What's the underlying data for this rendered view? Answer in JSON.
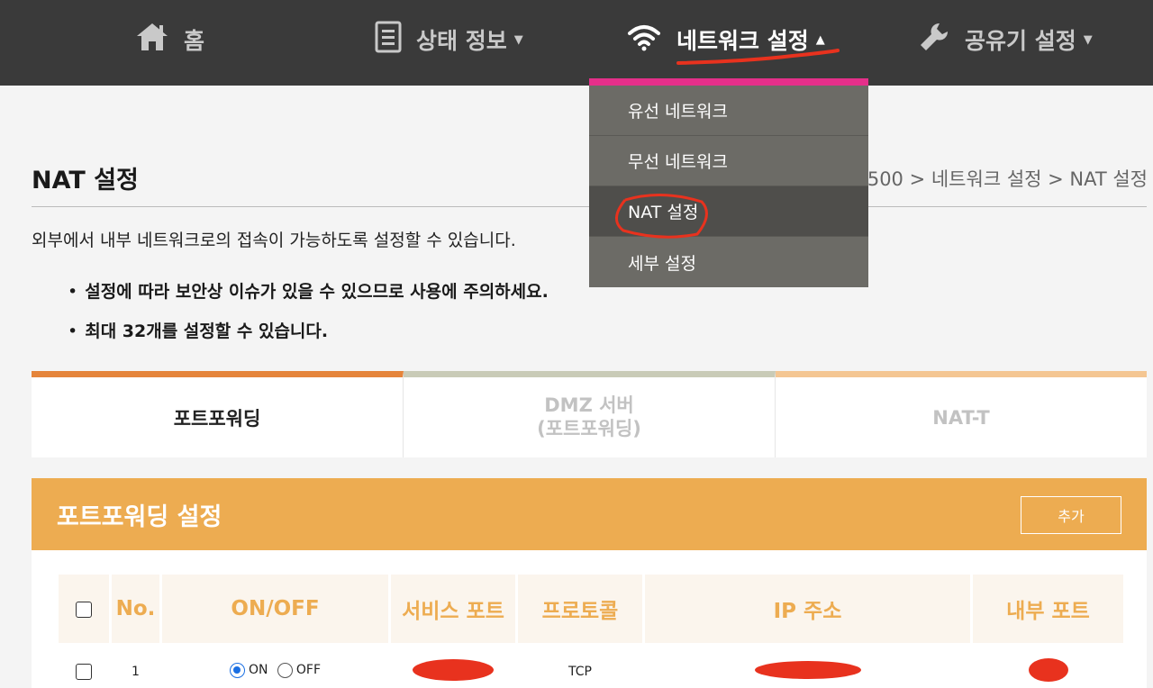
{
  "nav": {
    "items": [
      {
        "label": "홈",
        "icon": "home-icon"
      },
      {
        "label": "상태 정보",
        "icon": "document-icon"
      },
      {
        "label": "네트워크 설정",
        "icon": "wifi-icon"
      },
      {
        "label": "공유기 설정",
        "icon": "wrench-icon"
      }
    ]
  },
  "dropdown": {
    "items": [
      "유선 네트워크",
      "무선 네트워크",
      "NAT 설정",
      "세부 설정"
    ]
  },
  "page": {
    "title": "NAT 설정",
    "breadcrumb": "M-7500 > 네트워크 설정 > NAT 설정",
    "description": "외부에서 내부 네트워크로의 접속이 가능하도록 설정할 수 있습니다.",
    "bullets": [
      "설정에 따라 보안상 이슈가 있을 수 있으므로 사용에 주의하세요.",
      "최대 32개를 설정할 수 있습니다."
    ]
  },
  "tabs": [
    {
      "label": "포트포워딩"
    },
    {
      "label_line1": "DMZ 서버",
      "label_line2": "(포트포워딩)"
    },
    {
      "label": "NAT-T"
    }
  ],
  "panel": {
    "title": "포트포워딩 설정",
    "add_label": "추가",
    "columns": [
      "No.",
      "ON/OFF",
      "서비스 포트",
      "프로토콜",
      "IP 주소",
      "내부 포트"
    ],
    "rows": [
      {
        "no": "1",
        "on_label": "ON",
        "off_label": "OFF",
        "state": "ON",
        "protocol": "TCP"
      }
    ]
  },
  "colors": {
    "accent_orange": "#edac51",
    "dropdown_bar": "#e52f8a",
    "annotation_red": "#e8321e"
  }
}
